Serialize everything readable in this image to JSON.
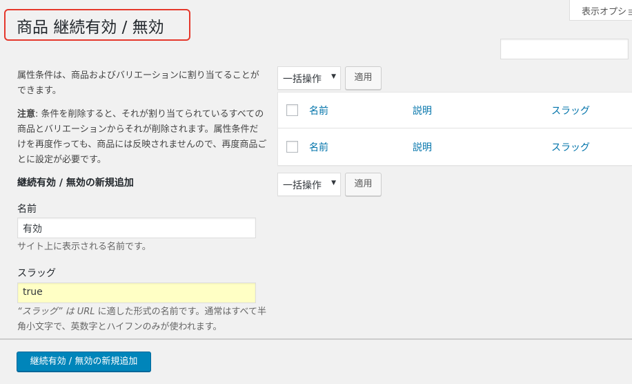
{
  "page": {
    "title": "商品 継続有効 / 無効",
    "screen_options": "表示オプション",
    "search": {
      "value": ""
    }
  },
  "intro": {
    "text": "属性条件は、商品およびバリエーションに割り当てることができます。",
    "note_label": "注意",
    "note_text": ": 条件を削除すると、それが割り当てられているすべての商品とバリエーションからそれが削除されます。属性条件だけを再度作っても、商品には反映されませんので、再度商品ごとに設定が必要です。"
  },
  "form": {
    "title": "継続有効 / 無効の新規追加",
    "name_label": "名前",
    "name_value": "有効",
    "name_help": "サイト上に表示される名前です。",
    "slug_label": "スラッグ",
    "slug_value": "true",
    "slug_help_1": "“スラッグ” は ",
    "slug_help_url": "URL",
    "slug_help_2": " に適した形式の名前です。通常はすべて半角小文字で、英数字とハイフンのみが使われます。",
    "submit_label": "継続有効 / 無効の新規追加"
  },
  "bulk": {
    "select_label": "一括操作",
    "apply_label": "適用"
  },
  "table": {
    "columns": [
      "名前",
      "説明",
      "スラッグ"
    ]
  },
  "colors": {
    "primary": "#0085ba",
    "link": "#0073aa",
    "highlight_border": "#e5372b",
    "slug_bg": "#ffffc5"
  }
}
